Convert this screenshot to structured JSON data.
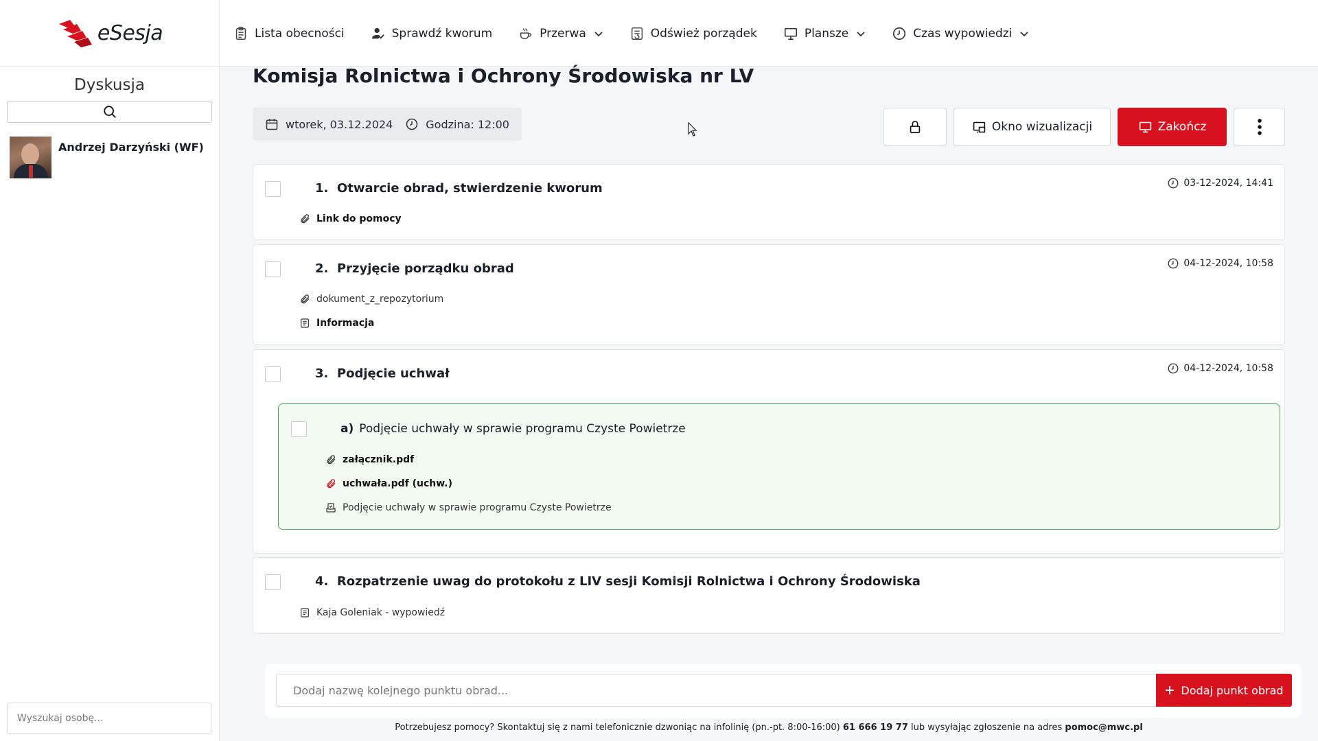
{
  "app": {
    "logo_text": "eSesja"
  },
  "nav": {
    "items": [
      {
        "label": "Lista obecności"
      },
      {
        "label": "Sprawdź kworum"
      },
      {
        "label": "Przerwa"
      },
      {
        "label": "Odśwież porządek"
      },
      {
        "label": "Plansze"
      },
      {
        "label": "Czas wypowiedzi"
      }
    ]
  },
  "sidebar": {
    "title": "Dyskusja",
    "people": [
      {
        "name": "Andrzej  Darzyński (WF)"
      }
    ],
    "people_search_placeholder": "Wyszukaj osobę..."
  },
  "session": {
    "title": "Komisja Rolnictwa i Ochrony Środowiska nr LV",
    "date": "wtorek, 03.12.2024",
    "time": "Godzina: 12:00"
  },
  "actions": {
    "visualization_label": "Okno wizualizacji",
    "end_label": "Zakończ"
  },
  "agenda": [
    {
      "number": "1.",
      "title": "Otwarcie obrad, stwierdzenie kworum",
      "timestamp": "03-12-2024, 14:41",
      "attachments": [
        {
          "label": "Link do pomocy",
          "icon": "paperclip-icon"
        }
      ]
    },
    {
      "number": "2.",
      "title": "Przyjęcie porządku obrad",
      "timestamp": "04-12-2024, 10:58",
      "attachments": [
        {
          "label": "dokument_z_repozytorium",
          "icon": "paperclip-icon"
        },
        {
          "label": "Informacja",
          "icon": "document-icon"
        }
      ]
    },
    {
      "number": "3.",
      "title": "Podjęcie uchwał",
      "timestamp": "04-12-2024, 10:58",
      "subitems": [
        {
          "letter": "a)",
          "title": "Podjęcie uchwały w sprawie programu Czyste Powietrze",
          "attachments": [
            {
              "label": "załącznik.pdf",
              "icon": "paperclip-icon"
            },
            {
              "label": "uchwała.pdf (uchw.)",
              "icon": "paperclip-red-icon"
            },
            {
              "label": "Podjęcie uchwały w sprawie programu Czyste Powietrze",
              "icon": "vote-icon"
            }
          ]
        }
      ]
    },
    {
      "number": "4.",
      "title": "Rozpatrzenie uwag do protokołu z LIV sesji Komisji Rolnictwa i Ochrony Środowiska",
      "timestamp": "",
      "attachments": [
        {
          "label": "Kaja Goleniak - wypowiedź",
          "icon": "document-icon"
        }
      ]
    }
  ],
  "add_point": {
    "placeholder": "Dodaj nazwę kolejnego punktu obrad...",
    "button_label": "Dodaj punkt obrad"
  },
  "footer": {
    "text": "Potrzebujesz pomocy? Skontaktuj się z nami telefonicznie dzwoniąc na infolinię (pn.-pt. 8:00-16:00)",
    "phone": "61 666 19 77",
    "middle": "lub wysyłając zgłoszenie na adres",
    "email": "pomoc@mwc.pl"
  },
  "colors": {
    "accent": "#d8111f",
    "success": "#4fae4f"
  }
}
